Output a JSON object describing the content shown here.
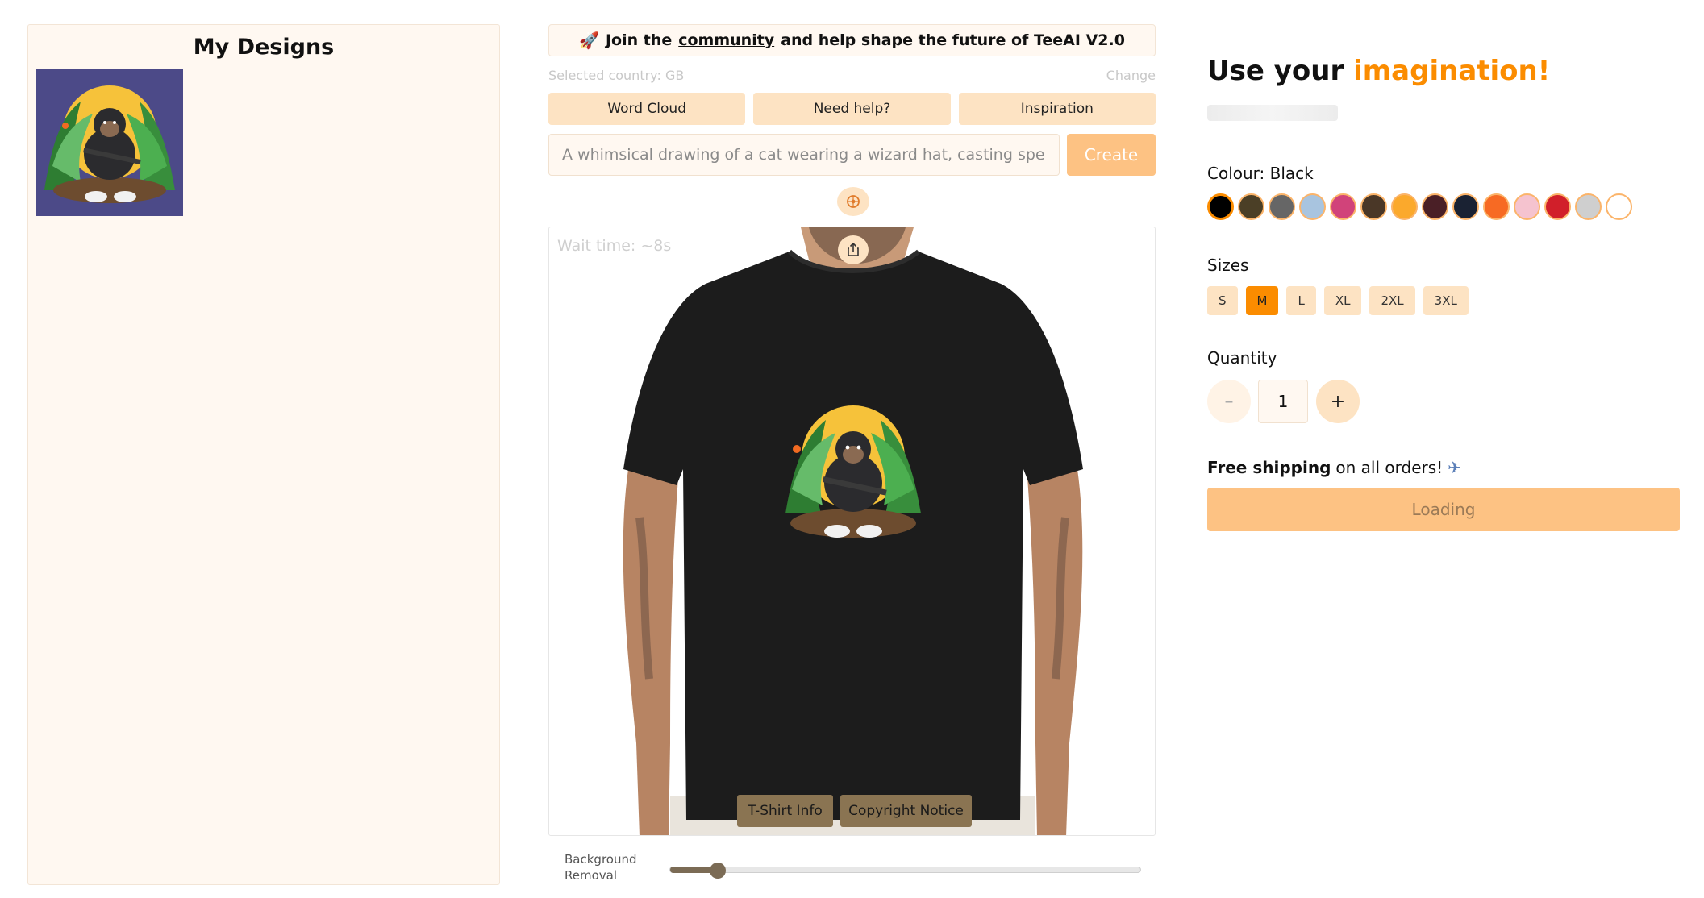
{
  "left_panel": {
    "title": "My Designs"
  },
  "banner": {
    "icon": "rocket-icon",
    "text_before": "Join the",
    "link_text": "community",
    "text_after": "and help shape the future of TeeAI V2.0"
  },
  "country": {
    "label": "Selected country: GB",
    "change": "Change"
  },
  "buttons": {
    "word_cloud": "Word Cloud",
    "need_help": "Need help?",
    "inspiration": "Inspiration"
  },
  "prompt": {
    "placeholder": "A whimsical drawing of a cat wearing a wizard hat, casting spells...",
    "create": "Create"
  },
  "preview": {
    "wait_text": "Wait time: ~8s",
    "tshirt_info": "T-Shirt Info",
    "copyright": "Copyright Notice"
  },
  "bg_removal": {
    "label": "Background Removal",
    "value": 0.1
  },
  "right": {
    "heading_plain": "Use your",
    "heading_accent": "imagination!",
    "colour_label": "Colour:",
    "colour_value": "Black",
    "colours": [
      "#000000",
      "#4b3f26",
      "#666666",
      "#a8c4df",
      "#d1437a",
      "#4a3727",
      "#fba92c",
      "#4a1f26",
      "#1a2233",
      "#f76a23",
      "#f5c3cf",
      "#d11f2a",
      "#cfcfcf",
      "#ffffff"
    ],
    "sizes_label": "Sizes",
    "sizes": [
      "S",
      "M",
      "L",
      "XL",
      "2XL",
      "3XL"
    ],
    "selected_size": "M",
    "quantity_label": "Quantity",
    "quantity": "1",
    "minus": "–",
    "plus": "+",
    "shipping_bold": "Free shipping",
    "shipping_rest": "on all orders!",
    "shipping_icon": "airplane-icon",
    "loading": "Loading"
  },
  "colors": {
    "accent": "#fb8c00",
    "button_bg": "#fde3c3",
    "panel_bg": "#fff8f1"
  }
}
